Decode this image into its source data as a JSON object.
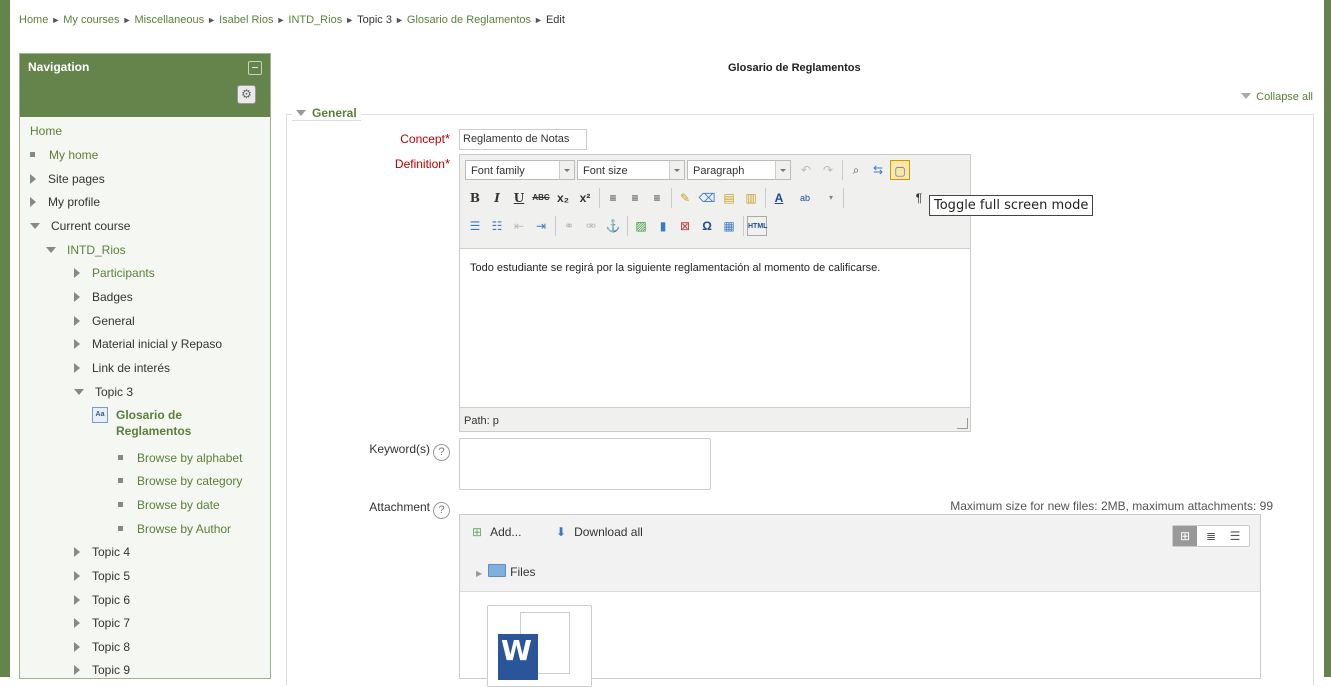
{
  "breadcrumb": {
    "items": [
      "Home",
      "My courses",
      "Miscellaneous",
      "Isabel Rios",
      "INTD_Rios",
      "Topic 3",
      "Glosario de Reglamentos",
      "Edit"
    ],
    "separator": "►"
  },
  "nav": {
    "title": "Navigation",
    "home": "Home",
    "my_home": "My home",
    "site_pages": "Site pages",
    "my_profile": "My profile",
    "current_course": "Current course",
    "course": "INTD_Rios",
    "participants": "Participants",
    "badges": "Badges",
    "general": "General",
    "material": "Material inicial y Repaso",
    "link": "Link de interés",
    "topic3": "Topic 3",
    "glosario_1": "Glosario de",
    "glosario_2": "Reglamentos",
    "browse_alpha": "Browse by alphabet",
    "browse_cat": "Browse by category",
    "browse_date": "Browse by date",
    "browse_author": "Browse by Author",
    "topics": [
      "Topic 4",
      "Topic 5",
      "Topic 6",
      "Topic 7",
      "Topic 8",
      "Topic 9"
    ]
  },
  "page_heading": "Glosario de Reglamentos",
  "collapse_all": "Collapse all",
  "general_legend": "General",
  "form": {
    "concept_label": "Concept",
    "concept_value": "Reglamento de Notas",
    "definition_label": "Definition",
    "keywords_label": "Keyword(s)",
    "attachment_label": "Attachment",
    "required_mark": "*"
  },
  "editor": {
    "font_family": "Font family",
    "font_size": "Font size",
    "format": "Paragraph",
    "content": "Todo estudiante se regirá por la siguiente reglamentación al momento de calificarse.",
    "path": "Path: p",
    "tooltip": "Toggle full screen mode"
  },
  "filemanager": {
    "max_size": "Maximum size for new files: 2MB, maximum attachments: 99",
    "add": "Add...",
    "download_all": "Download all",
    "files": "Files"
  }
}
